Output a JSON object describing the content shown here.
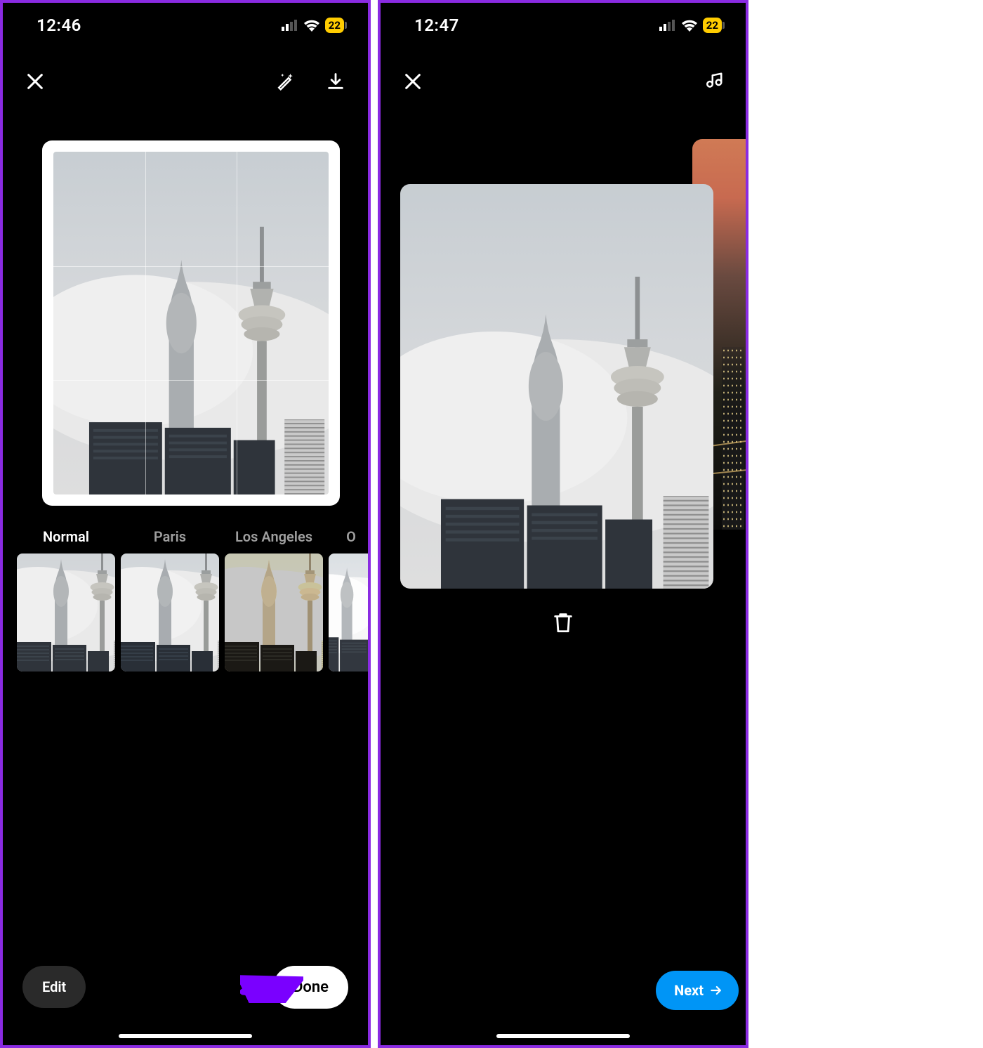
{
  "colors": {
    "accent_purple": "#8a2be2",
    "arrow_purple": "#7a00ff",
    "cta_blue": "#0095f6",
    "battery_yellow": "#ffcc00"
  },
  "left_screen": {
    "status": {
      "time": "12:46",
      "battery": "22"
    },
    "filters": [
      {
        "label": "Normal",
        "selected": true
      },
      {
        "label": "Paris"
      },
      {
        "label": "Los Angeles"
      },
      {
        "label": "O",
        "partial": true
      }
    ],
    "buttons": {
      "edit": "Edit",
      "done": "Done"
    }
  },
  "right_screen": {
    "status": {
      "time": "12:47",
      "battery": "22"
    },
    "buttons": {
      "next": "Next"
    }
  }
}
